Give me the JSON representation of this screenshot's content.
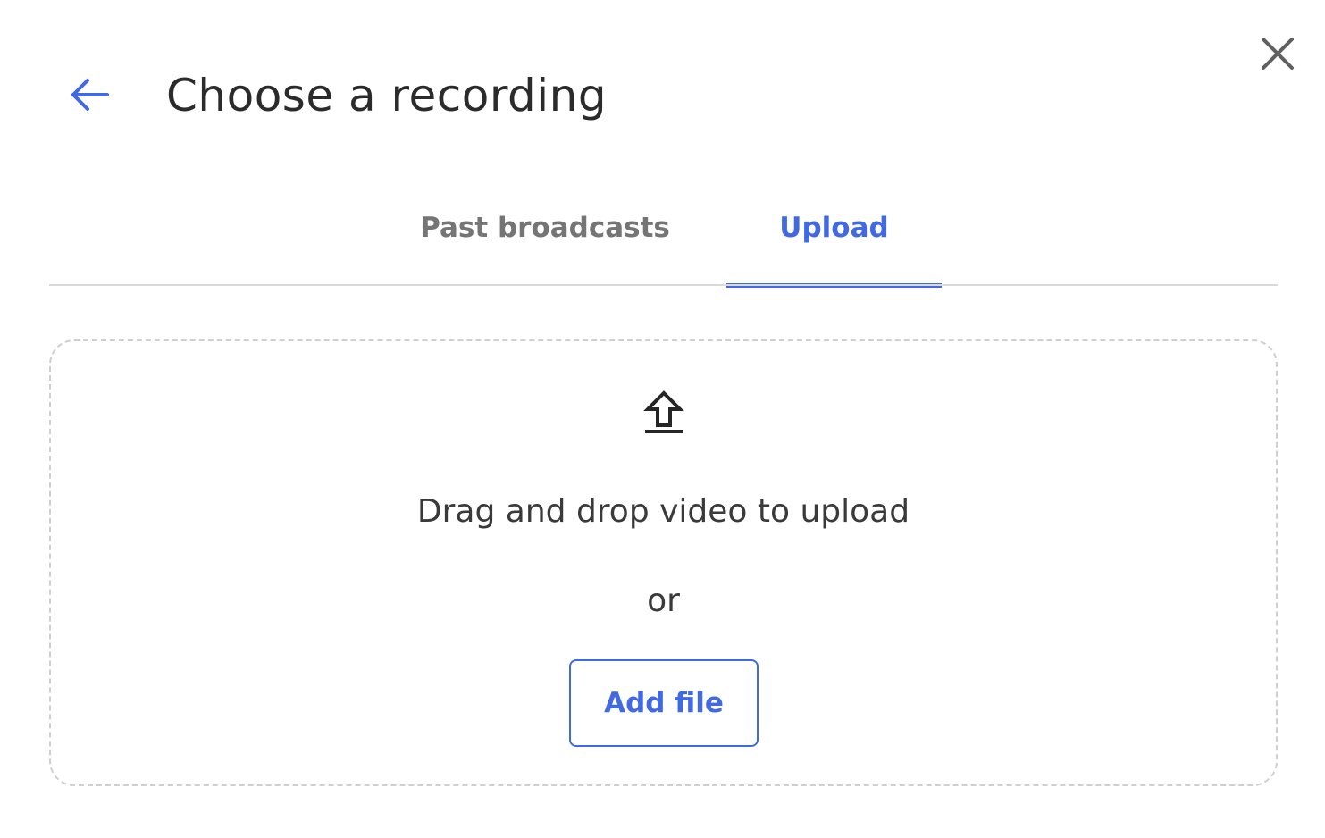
{
  "header": {
    "title": "Choose a recording",
    "back_icon": "arrow-left-icon",
    "close_icon": "close-icon"
  },
  "tabs": [
    {
      "label": "Past broadcasts",
      "active": false
    },
    {
      "label": "Upload",
      "active": true
    }
  ],
  "dropzone": {
    "icon": "upload-icon",
    "instruction": "Drag and drop video to upload",
    "separator": "or",
    "add_file_label": "Add file"
  },
  "colors": {
    "accent": "#4169e1",
    "title_text": "#2b2b2b",
    "inactive_tab": "#757575",
    "body_text": "#3a3a3a",
    "divider": "#d9d9d9",
    "dropzone_border": "#cfcfcf"
  }
}
